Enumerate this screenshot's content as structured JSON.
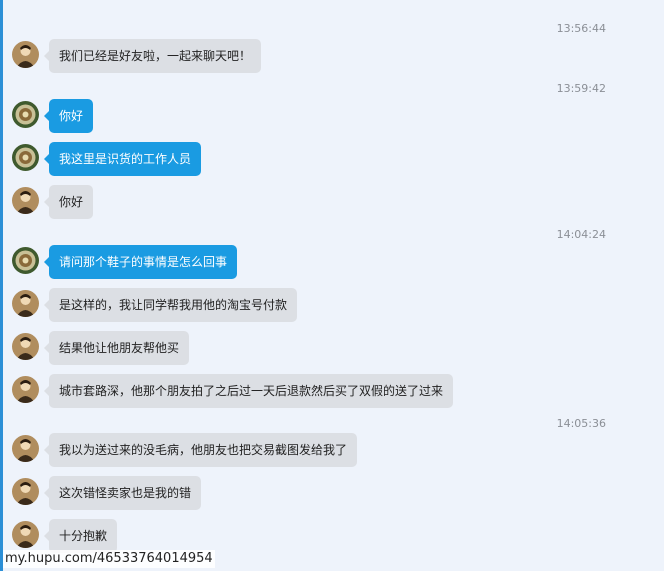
{
  "timestamps": [
    "13:56:44",
    "13:59:42",
    "14:04:24",
    "14:05:36"
  ],
  "messages": [
    {
      "who": "other",
      "text": "我们已经是好友啦，一起来聊天吧！"
    },
    {
      "who": "self",
      "text": "你好"
    },
    {
      "who": "self",
      "text": "我这里是识货的工作人员"
    },
    {
      "who": "other",
      "text": "你好"
    },
    {
      "who": "self",
      "text": "请问那个鞋子的事情是怎么回事"
    },
    {
      "who": "other",
      "text": "是这样的，我让同学帮我用他的淘宝号付款"
    },
    {
      "who": "other",
      "text": "结果他让他朋友帮他买"
    },
    {
      "who": "other",
      "text": "城市套路深，他那个朋友拍了之后过一天后退款然后买了双假的送了过来"
    },
    {
      "who": "other",
      "text": "我以为送过来的没毛病，他朋友也把交易截图发给我了"
    },
    {
      "who": "other",
      "text": "这次错怪卖家也是我的错"
    },
    {
      "who": "other",
      "text": "十分抱歉"
    }
  ],
  "watermark": "my.hupu.com/46533764014954",
  "colors": {
    "self_bubble": "#1a9be2",
    "other_bubble": "#dcdfe4",
    "background": "#eef3fb"
  },
  "icons": {
    "other_avatar": "user-avatar-icon",
    "self_avatar": "staff-avatar-icon"
  }
}
